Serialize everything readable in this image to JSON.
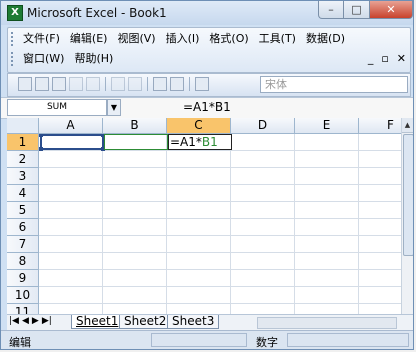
{
  "window": {
    "title": "Microsoft Excel - Book1",
    "app_icon": "X"
  },
  "menus_row1": [
    "文件(F)",
    "编辑(E)",
    "视图(V)",
    "插入(I)",
    "格式(O)",
    "工具(T)",
    "数据(D)"
  ],
  "menus_row2": [
    "窗口(W)",
    "帮助(H)"
  ],
  "toolbar": {
    "font_name": "宋体"
  },
  "formula_bar": {
    "name_box": "SUM",
    "formula": "=A1*B1"
  },
  "grid": {
    "columns": [
      "A",
      "B",
      "C",
      "D",
      "E",
      "F"
    ],
    "active_column": "C",
    "rows": [
      "1",
      "2",
      "3",
      "4",
      "5",
      "6",
      "7",
      "8",
      "9",
      "10",
      "11"
    ],
    "active_row": "1",
    "c1_edit_prefix": "=A1*",
    "c1_edit_ref": "B1"
  },
  "sheets": [
    "Sheet1",
    "Sheet2",
    "Sheet3"
  ],
  "status": {
    "mode": "编辑",
    "indicator": "数字"
  },
  "colors": {
    "active_header": "#f9c46b",
    "ref_a1": "#2b4d8c",
    "ref_b1": "#2d8c35"
  }
}
